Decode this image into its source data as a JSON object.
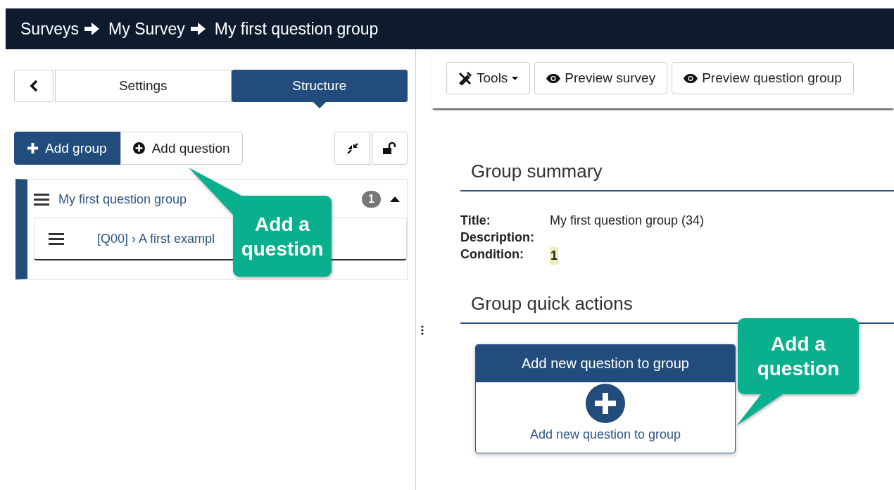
{
  "breadcrumbs": [
    {
      "label": "Surveys"
    },
    {
      "label": "My Survey"
    },
    {
      "label": "My first question group"
    }
  ],
  "sidebar": {
    "tabs": [
      {
        "label": "Settings",
        "selected": false
      },
      {
        "label": "Structure",
        "selected": true
      }
    ],
    "actions": [
      {
        "label": "Add group",
        "kind": "primary"
      },
      {
        "label": "Add question",
        "kind": "secondary"
      }
    ],
    "groups": [
      {
        "title": "My first question group",
        "count": "1",
        "expanded": true,
        "children": [
          {
            "title": "[Q00] › A first exampl"
          }
        ]
      }
    ]
  },
  "toolbar": [
    {
      "label": "Tools",
      "kind": "dropdown"
    },
    {
      "label": "Preview survey",
      "kind": "preview"
    },
    {
      "label": "Preview question group",
      "kind": "preview"
    }
  ],
  "summary": {
    "heading": "Group summary",
    "fields": [
      {
        "label": "Title:",
        "value": "My first question group (34)",
        "kind": "plain"
      },
      {
        "label": "Description:"
      },
      {
        "label": "Condition:",
        "value": "1",
        "kind": "highlight"
      }
    ]
  },
  "quick_actions": {
    "heading": "Group quick actions",
    "cards": [
      {
        "header": "Add new question to group",
        "label": "Add new question to group"
      }
    ]
  },
  "callouts": [
    {
      "text": "Add a question"
    },
    {
      "text": "Add a question"
    }
  ]
}
